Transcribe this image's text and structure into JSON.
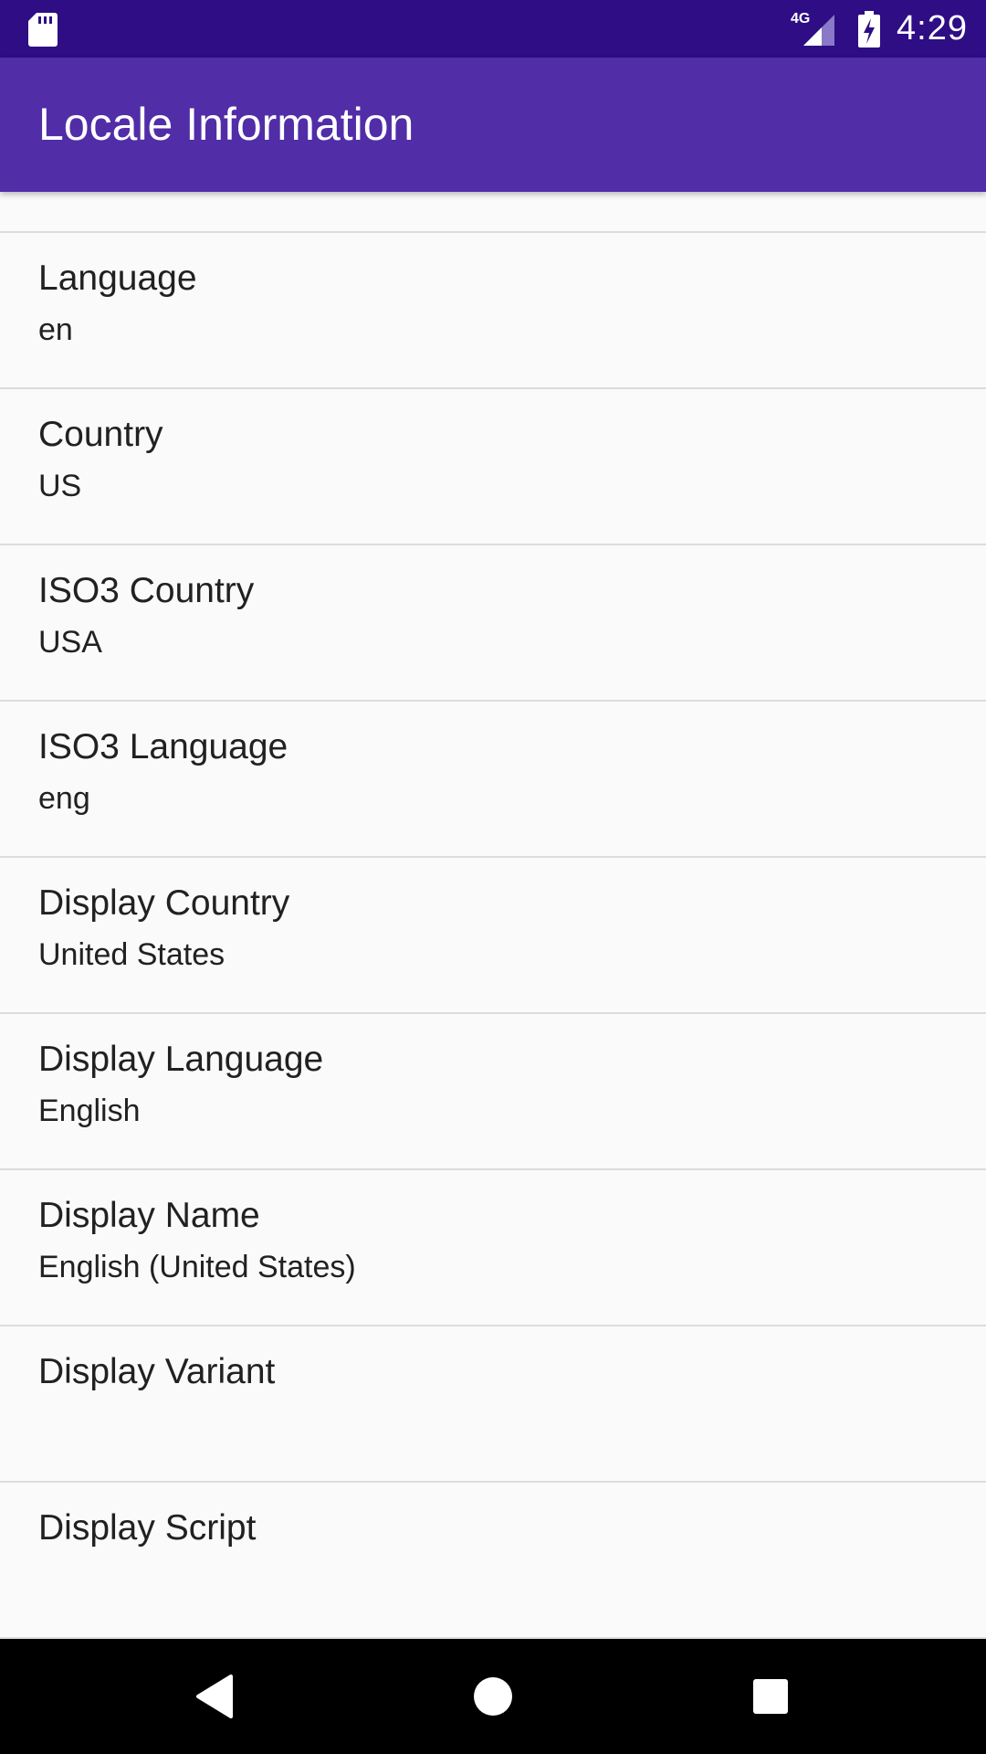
{
  "status_bar": {
    "time": "4:29",
    "network": "4G",
    "icons": [
      "sd-card-icon",
      "signal-icon",
      "battery-charging-icon"
    ]
  },
  "app_bar": {
    "title": "Locale Information",
    "color": "#512da8"
  },
  "items": [
    {
      "label": "Language",
      "value": "en"
    },
    {
      "label": "Country",
      "value": "US"
    },
    {
      "label": "ISO3 Country",
      "value": "USA"
    },
    {
      "label": "ISO3 Language",
      "value": "eng"
    },
    {
      "label": "Display Country",
      "value": "United States"
    },
    {
      "label": "Display Language",
      "value": "English"
    },
    {
      "label": "Display Name",
      "value": "English (United States)"
    },
    {
      "label": "Display Variant",
      "value": ""
    },
    {
      "label": "Display Script",
      "value": ""
    }
  ],
  "nav_bar": {
    "buttons": [
      "back-icon",
      "home-icon",
      "recents-icon"
    ]
  }
}
